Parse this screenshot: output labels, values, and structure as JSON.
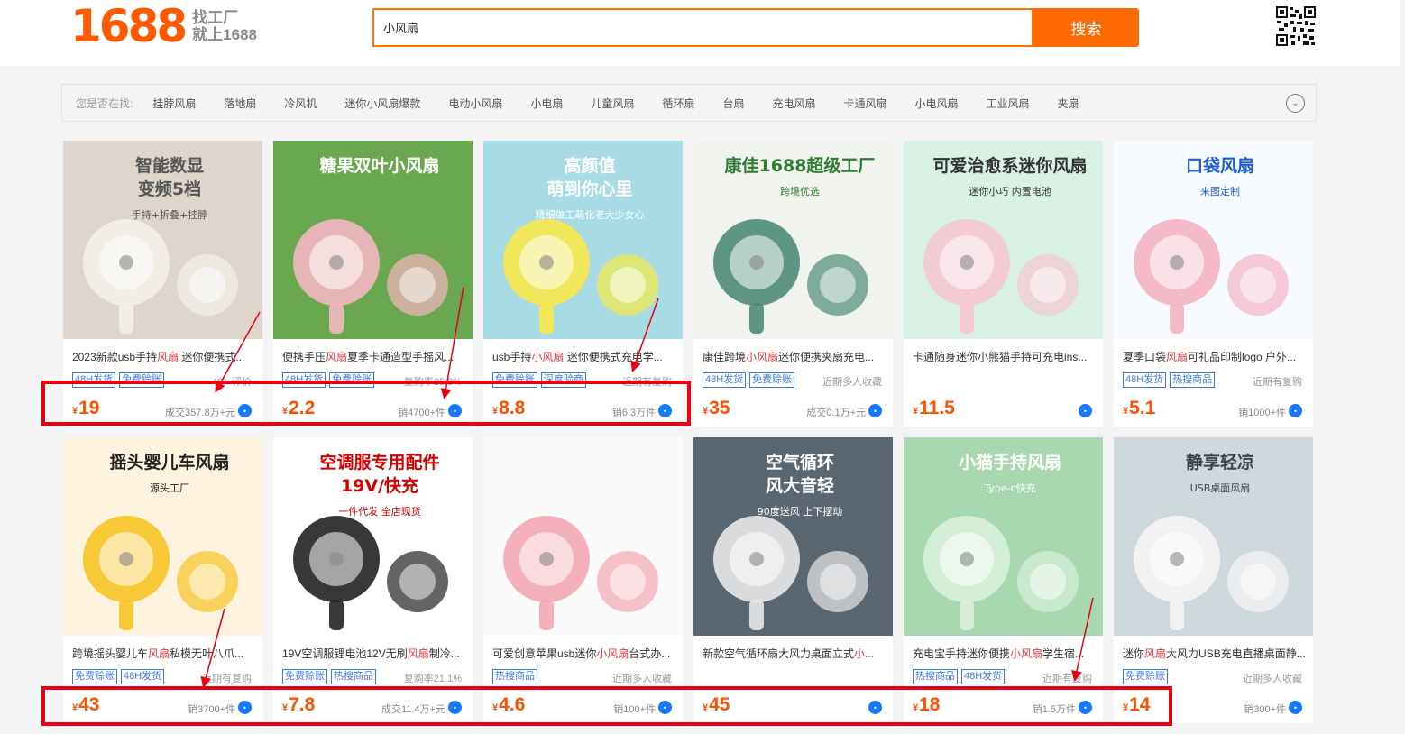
{
  "header": {
    "logo_number": "1688",
    "logo_line1": "找工厂",
    "logo_line2": "就上1688",
    "search_value": "小风扇",
    "search_button": "搜索"
  },
  "suggestions": {
    "label": "您是否在找:",
    "items": [
      "挂脖风扇",
      "落地扇",
      "冷风机",
      "迷你小风扇爆款",
      "电动小风扇",
      "小电扇",
      "儿童风扇",
      "循环扇",
      "台扇",
      "充电风扇",
      "卡通风扇",
      "小电风扇",
      "工业风扇",
      "夹扇"
    ]
  },
  "products": [
    {
      "title_pre": "2023新款usb手持",
      "title_hl": "风扇",
      "title_post": " 迷你便携式...",
      "tags": [
        "48H发货",
        "免费赊账"
      ],
      "meta": "49+ 评价",
      "price": "19",
      "sales": "成交357.8万+元",
      "img": {
        "bg": "#ded6cc",
        "caption": "智能数显\n变频5档",
        "sub": "手持+折叠+挂脖",
        "cap_color": "#555555",
        "accent": "#f4efe8"
      }
    },
    {
      "title_pre": "便携手压",
      "title_hl": "风扇",
      "title_post": "夏季卡通造型手摇风...",
      "tags": [
        "48H发货",
        "免费赊账"
      ],
      "meta": "复购率25.8%",
      "price": "2.2",
      "sales": "销4700+件",
      "img": {
        "bg": "#6aa84f",
        "caption": "糖果双叶小风扇",
        "sub": "",
        "cap_color": "#ffffff",
        "accent": "#f4b6c2"
      }
    },
    {
      "title_pre": "usb手持",
      "title_hl": "小风扇",
      "title_post": " 迷你便携式充电学...",
      "tags": [
        "免费赊账",
        "深度验商"
      ],
      "meta": "近期有复购",
      "price": "8.8",
      "sales": "销6.3万件",
      "img": {
        "bg": "#a8dce4",
        "caption": "高颜值\n萌到你心里",
        "sub": "精细做工萌化老大少女心",
        "cap_color": "#ffffff",
        "accent": "#f7e94a"
      }
    },
    {
      "title_pre": "康佳跨境",
      "title_hl": "小风扇",
      "title_post": "迷你便携夹扇充电...",
      "tags": [
        "48H发货",
        "免费赊账"
      ],
      "meta": "近期多人收藏",
      "price": "35",
      "sales": "成交0.1万+元",
      "img": {
        "bg": "#f1f4ee",
        "caption": "康佳1688超级工厂",
        "sub": "跨境优选",
        "cap_color": "#2e7d32",
        "accent": "#4e8c79"
      }
    },
    {
      "title_pre": "卡通随身迷你小熊猫手持可充电ins...",
      "title_hl": "",
      "title_post": "",
      "tags": [],
      "meta": "",
      "price": "11.5",
      "sales": "",
      "img": {
        "bg": "#d9f1e4",
        "caption": "可爱治愈系迷你风扇",
        "sub": "迷你小巧 内置电池",
        "cap_color": "#333333",
        "accent": "#f4c7d3"
      }
    },
    {
      "title_pre": "夏季口袋",
      "title_hl": "风扇",
      "title_post": "可礼品印制logo 户外...",
      "tags": [
        "48H发货",
        "热搜商品"
      ],
      "meta": "近期有复购",
      "price": "5.1",
      "sales": "销1000+件",
      "img": {
        "bg": "#f7fbff",
        "caption": "口袋风扇",
        "sub": "来图定制",
        "cap_color": "#1e5bd6",
        "accent": "#f3b3c4"
      }
    },
    {
      "title_pre": "跨境摇头婴儿车",
      "title_hl": "风扇",
      "title_post": "私模无叶八爪...",
      "tags": [
        "免费赊账",
        "48H发货"
      ],
      "meta": "近期有复购",
      "price": "43",
      "sales": "销3700+件",
      "img": {
        "bg": "#fdf3df",
        "caption": "摇头婴儿车风扇",
        "sub": "源头工厂",
        "cap_color": "#222222",
        "accent": "#f7c325"
      }
    },
    {
      "title_pre": "19V空调服锂电池12V无刷",
      "title_hl": "风扇",
      "title_post": "制冷...",
      "tags": [
        "免费赊账",
        "热搜商品"
      ],
      "meta": "复购率21.1%",
      "price": "7.8",
      "sales": "成交11.4万+元",
      "img": {
        "bg": "#ffffff",
        "caption": "空调服专用配件\n19V/快充",
        "sub": "一件代发 全店现货",
        "cap_color": "#d40000",
        "accent": "#222222"
      }
    },
    {
      "title_pre": "可爱创意苹果usb迷你",
      "title_hl": "小风扇",
      "title_post": "台式办...",
      "tags": [
        "热搜商品"
      ],
      "meta": "近期多人收藏",
      "price": "4.6",
      "sales": "销100+件",
      "img": {
        "bg": "#fafafa",
        "caption": "",
        "sub": "",
        "cap_color": "#333333",
        "accent": "#f3a7b3"
      }
    },
    {
      "title_pre": "新款空气循环扇大风力桌面立式",
      "title_hl": "小...",
      "title_post": "",
      "tags": [],
      "meta": "",
      "price": "45",
      "sales": "",
      "img": {
        "bg": "#5a6670",
        "caption": "空气循环\n风大音轻",
        "sub": "90度送风 上下摆动",
        "cap_color": "#ffffff",
        "accent": "#e8e8e8"
      }
    },
    {
      "title_pre": "充电宝手持迷你便携",
      "title_hl": "小风扇",
      "title_post": "学生宿...",
      "tags": [
        "热搜商品",
        "48H发货"
      ],
      "meta": "近期有复购",
      "price": "18",
      "sales": "销1.5万件",
      "img": {
        "bg": "#a8d8b0",
        "caption": "小猫手持风扇",
        "sub": "Type-c快充",
        "cap_color": "#ffffff",
        "accent": "#d8f0dc"
      }
    },
    {
      "title_pre": "迷你",
      "title_hl": "风扇",
      "title_post": "大风力USB充电直播桌面静...",
      "tags": [
        "免费赊账"
      ],
      "meta": "近期多人收藏",
      "price": "14",
      "sales": "销300+件",
      "img": {
        "bg": "#cfd8dc",
        "caption": "静享轻凉",
        "sub": "USB桌面风扇",
        "cap_color": "#37474f",
        "accent": "#f5f5f5"
      }
    }
  ],
  "colors": {
    "brand": "#ff6a00",
    "price": "#ff5000",
    "highlight": "#e4393c",
    "tag": "#3b7be0",
    "annotation": "#e60012"
  },
  "icons": {
    "wangwang": "chat-bubble-icon",
    "expand": "chevron-down-icon",
    "qrcode": "qrcode-icon"
  }
}
